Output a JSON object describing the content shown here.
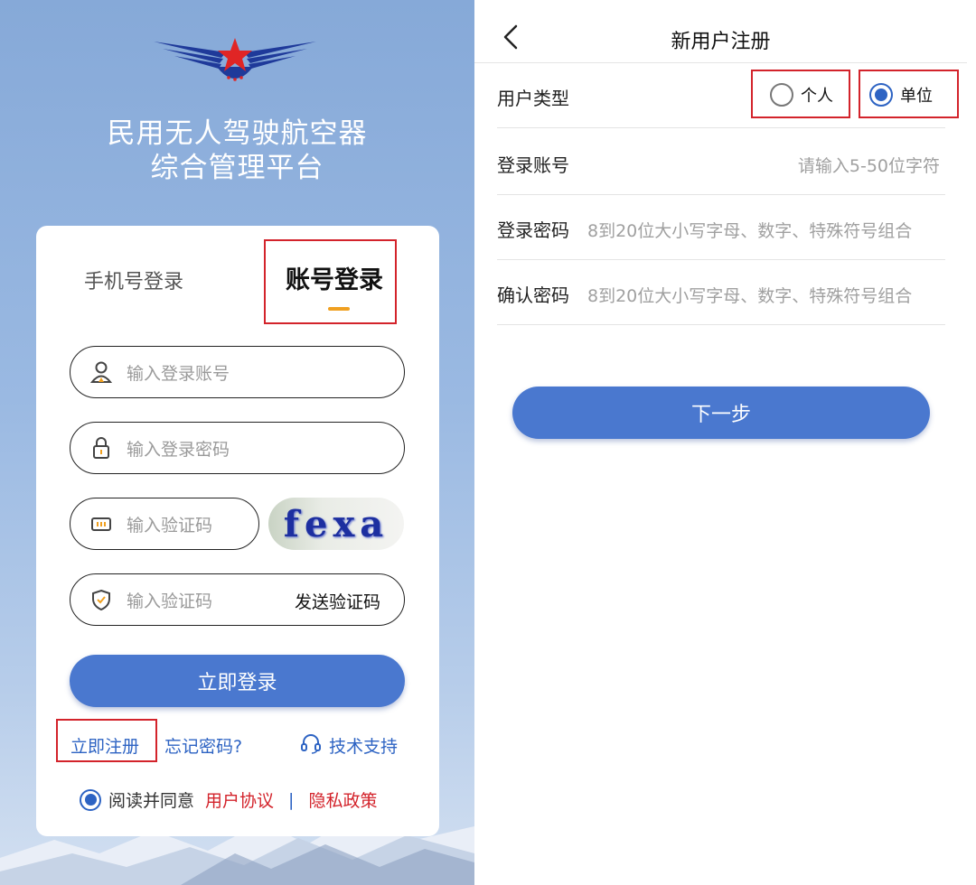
{
  "login": {
    "platform_title_line1": "民用无人驾驶航空器",
    "platform_title_line2": "综合管理平台",
    "tabs": {
      "phone": "手机号登录",
      "account": "账号登录"
    },
    "active_tab": "account",
    "account_placeholder": "输入登录账号",
    "password_placeholder": "输入登录密码",
    "captcha_placeholder": "输入验证码",
    "captcha_text": "fexa",
    "sms_placeholder": "输入验证码",
    "send_code_label": "发送验证码",
    "login_button": "立即登录",
    "register_link": "立即注册",
    "forgot_link": "忘记密码?",
    "support_link": "技术支持",
    "agree_text": "阅读并同意",
    "user_agreement": "用户协议",
    "separator": "|",
    "privacy_policy": "隐私政策",
    "agree_checked": true
  },
  "register": {
    "title": "新用户注册",
    "user_type_label": "用户类型",
    "user_type_options": [
      "个人",
      "单位"
    ],
    "user_type_selected": "单位",
    "account_label": "登录账号",
    "account_placeholder": "请输入5-50位字符",
    "password_label": "登录密码",
    "password_placeholder": "8到20位大小写字母、数字、特殊符号组合",
    "confirm_label": "确认密码",
    "confirm_placeholder": "8到20位大小写字母、数字、特殊符号组合",
    "next_button": "下一步"
  },
  "colors": {
    "primary_button": "#4a78cf",
    "link_blue": "#2d63c3",
    "highlight_red": "#d3232b",
    "tab_indicator": "#f0a020"
  }
}
